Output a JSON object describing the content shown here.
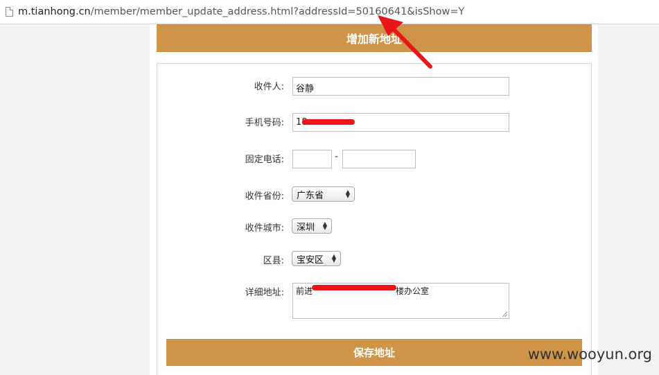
{
  "browser": {
    "url_host": "m.tianhong.cn",
    "url_path": "/member/member_update_address.html?addressId=50160641&isShow=Y"
  },
  "header": {
    "title": "增加新地址"
  },
  "form": {
    "recipient_label": "收件人:",
    "recipient_value": "谷静",
    "phone_label": "手机号码:",
    "phone_value": "18",
    "landline_label": "固定电话:",
    "landline_separator": "-",
    "province_label": "收件省份:",
    "province_value": "广东省",
    "city_label": "收件城市:",
    "city_value": "深圳",
    "district_label": "区县:",
    "district_value": "宝安区",
    "address_label": "详细地址:",
    "address_prefix": "前进",
    "address_suffix": "楼办公室"
  },
  "save_button": "保存地址",
  "watermark": "www.wooyun.org",
  "colors": {
    "accent": "#cf9447",
    "annotation": "#e8161b"
  }
}
